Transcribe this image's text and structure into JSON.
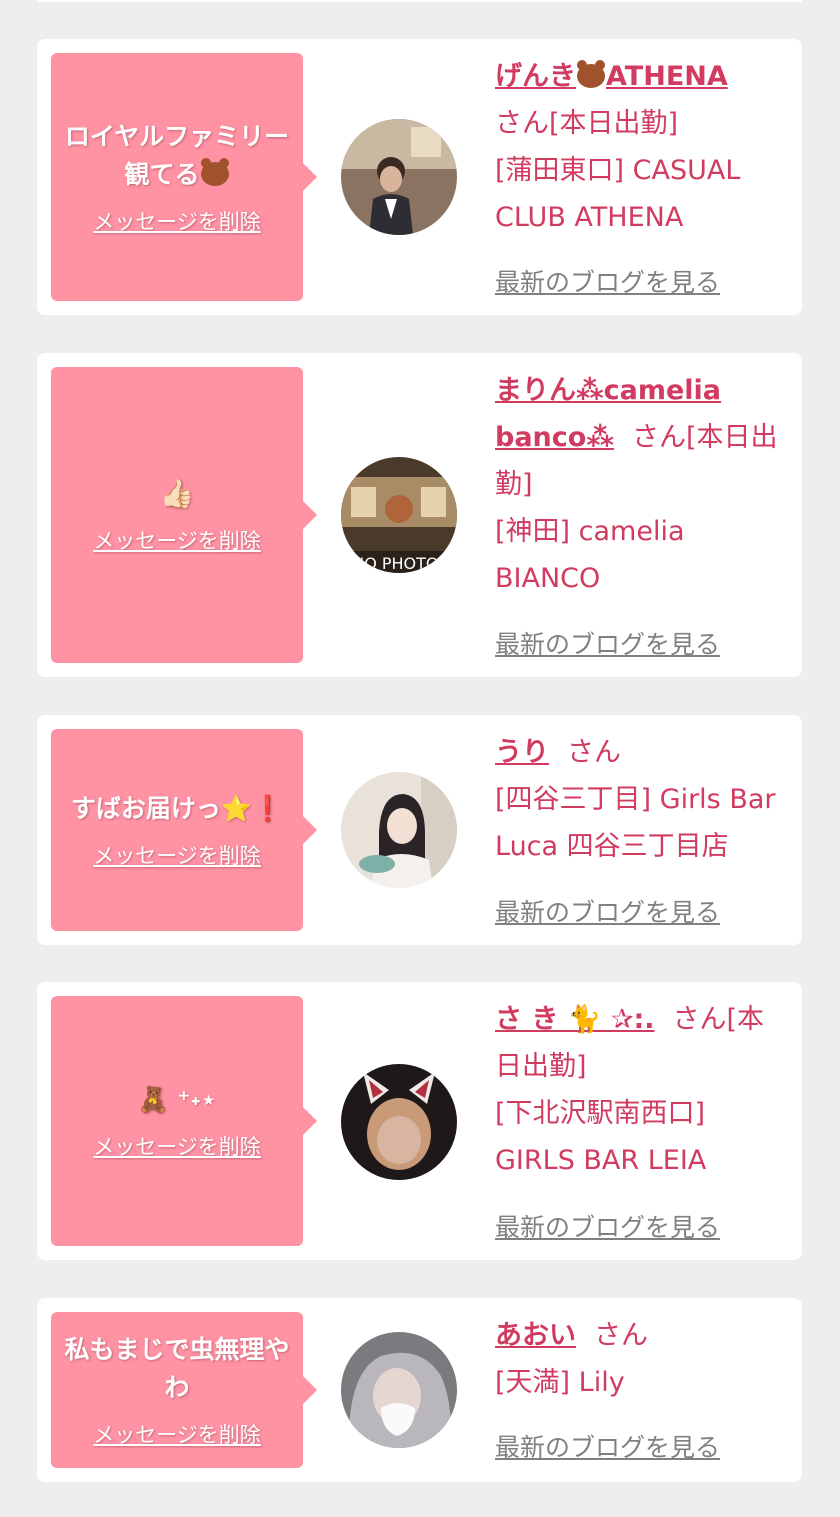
{
  "common": {
    "delete_label": "メッセージを削除",
    "blog_label": "最新のブログを見る"
  },
  "cards": [
    {
      "message_text": "ロイヤルファミリー観てる",
      "message_emoji": "bear",
      "name": "げんき",
      "name_suffix": "ATHENA",
      "name_emoji": "bear",
      "honorific": "さん[本日出勤]",
      "shop": "[蒲田東口] CASUAL CLUB ATHENA"
    },
    {
      "message_text": "",
      "message_emoji": "👍🏻",
      "name": "まりん⁂camelia banco⁂",
      "honorific": "さん[本日出勤]",
      "shop": "[神田] camelia BIANCO"
    },
    {
      "message_text": "すばお届けっ⭐️❗️",
      "name": "うり",
      "honorific": "さん",
      "shop": "[四谷三丁目] Girls Bar Luca 四谷三丁目店"
    },
    {
      "message_text": "🧸 ⁺˖⋆",
      "name": "さ き 🐈 ✰:.",
      "honorific": "さん[本日出勤]",
      "shop": "[下北沢駅南西口] GIRLS BAR LEIA"
    },
    {
      "message_text": "私もまじで虫無理やわ",
      "name": "あおい",
      "honorific": "さん",
      "shop": "[天満] Lily"
    }
  ],
  "colors": {
    "page_bg": "#eeeeee",
    "bubble": "#ff93a4",
    "accent": "#d13b60",
    "link_gray": "#808080"
  }
}
